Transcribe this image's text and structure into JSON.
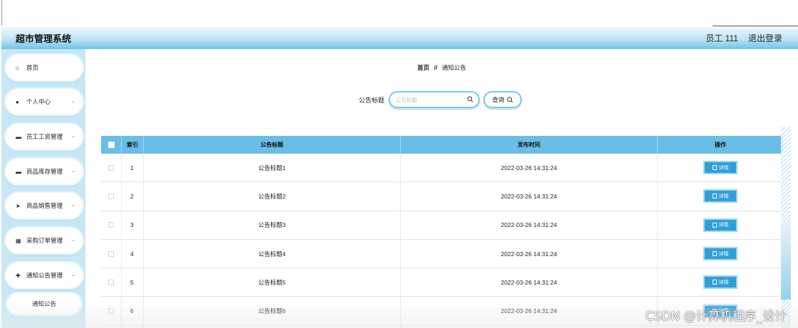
{
  "header": {
    "title": "超市管理系统",
    "user": "员工 111",
    "logout": "退出登录"
  },
  "sidebar": {
    "items": [
      {
        "label": "首页",
        "icon": "home-icon",
        "glyph": "⌂",
        "has_children": false
      },
      {
        "label": "个人中心",
        "icon": "user-icon",
        "glyph": "●",
        "has_children": true
      },
      {
        "label": "员工工资管理",
        "icon": "monitor-icon",
        "glyph": "▬",
        "has_children": true
      },
      {
        "label": "商品库存管理",
        "icon": "monitor-icon",
        "glyph": "▬",
        "has_children": true
      },
      {
        "label": "商品销售管理",
        "icon": "send-icon",
        "glyph": "➤",
        "has_children": true
      },
      {
        "label": "采购订单管理",
        "icon": "grid-icon",
        "glyph": "▦",
        "has_children": true
      },
      {
        "label": "通知公告管理",
        "icon": "thumb-icon",
        "glyph": "✚",
        "has_children": true
      }
    ],
    "chevron": "⌄",
    "subitem": "通知公告"
  },
  "breadcrumb": {
    "home": "首页",
    "separator": "//",
    "current": "通知公告"
  },
  "search": {
    "label": "公告标题",
    "placeholder": "公告标题",
    "button": "查询"
  },
  "table": {
    "columns": [
      "索引",
      "公告标题",
      "发布时间",
      "操作"
    ],
    "rows": [
      {
        "index": "1",
        "title": "公告标题1",
        "time": "2022-03-26 14:31:24"
      },
      {
        "index": "2",
        "title": "公告标题2",
        "time": "2022-03-26 14:31:24"
      },
      {
        "index": "3",
        "title": "公告标题3",
        "time": "2022-03-26 14:31:24"
      },
      {
        "index": "4",
        "title": "公告标题4",
        "time": "2022-03-26 14:31:24"
      },
      {
        "index": "5",
        "title": "公告标题5",
        "time": "2022-03-26 14:31:24"
      },
      {
        "index": "6",
        "title": "公告标题6",
        "time": "2022-03-26 14:31:24"
      }
    ],
    "detail_label": "详情"
  },
  "colors": {
    "accent": "#69bde6",
    "button": "#2f9fd8",
    "sidebar_bg": "#c7e7f7"
  },
  "watermark": "CSDN @计算机程序_设计"
}
